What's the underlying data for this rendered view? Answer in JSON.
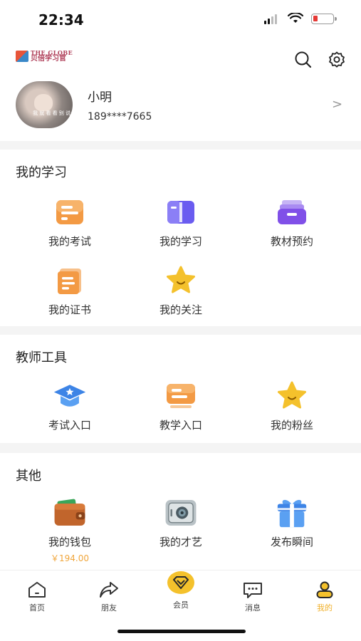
{
  "status": {
    "time": "22:34"
  },
  "header": {
    "logo_en": "THE GLOBE",
    "logo_cn": "贝倍学习官",
    "user_name": "小明",
    "user_phone": "189****7665",
    "avatar_caption": "我 就 看 看 别 说 话 吧 就 喝 茶"
  },
  "study": {
    "title": "我的学习",
    "items": [
      {
        "label": "我的考试",
        "icon": "exam-icon"
      },
      {
        "label": "我的学习",
        "icon": "book-icon"
      },
      {
        "label": "教材预约",
        "icon": "inbox-icon"
      },
      {
        "label": "我的证书",
        "icon": "certificate-icon"
      },
      {
        "label": "我的关注",
        "icon": "star-icon"
      }
    ]
  },
  "teacher": {
    "title": "教师工具",
    "items": [
      {
        "label": "考试入口",
        "icon": "grad-cap-icon"
      },
      {
        "label": "教学入口",
        "icon": "teach-icon"
      },
      {
        "label": "我的粉丝",
        "icon": "star-icon"
      }
    ]
  },
  "other": {
    "title": "其他",
    "items": [
      {
        "label": "我的钱包",
        "sub": "￥194.00",
        "icon": "wallet-icon"
      },
      {
        "label": "我的才艺",
        "icon": "safe-icon"
      },
      {
        "label": "发布瞬间",
        "icon": "gift-icon"
      }
    ]
  },
  "tabbar": {
    "items": [
      {
        "label": "首页",
        "icon": "home-icon"
      },
      {
        "label": "朋友",
        "icon": "share-icon"
      },
      {
        "label": "会员",
        "icon": "vip-icon"
      },
      {
        "label": "消息",
        "icon": "message-icon"
      },
      {
        "label": "我的",
        "icon": "profile-icon"
      }
    ],
    "active": "我的"
  },
  "colors": {
    "accent": "#f0b02a",
    "orange": "#f39a44",
    "purple": "#6a5cf0",
    "blue": "#3d84e6"
  }
}
